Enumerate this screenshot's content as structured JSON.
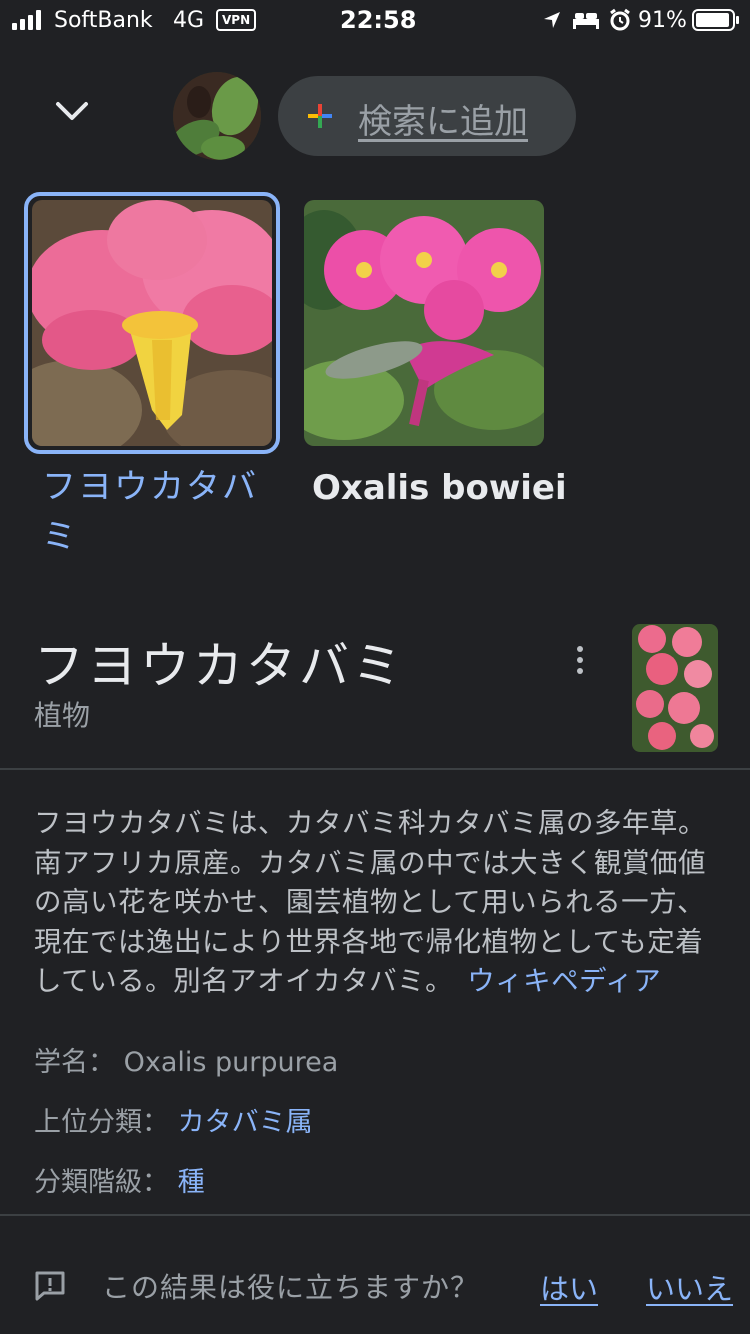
{
  "status_bar": {
    "carrier": "SoftBank",
    "network": "4G",
    "vpn": "VPN",
    "time": "22:58",
    "battery": "91%"
  },
  "header": {
    "add_to_search_label": "検索に追加"
  },
  "suggestions": [
    {
      "label_line1": "フヨウカタバ",
      "label_line2": "ミ",
      "selected": true
    },
    {
      "label": "Oxalis bowiei",
      "selected": false
    }
  ],
  "knowledge_panel": {
    "title": "フヨウカタバミ",
    "subtitle": "植物",
    "description_lines": [
      "フヨウカタバミは、カタバミ科カタバミ属の多年草。",
      "南アフリカ原産。カタバミ属の中では大きく観賞価値",
      "の高い花を咲かせ、園芸植物として用いられる一方、",
      "現在では逸出により世界各地で帰化植物としても定着",
      "している。別名アオイカタバミ。"
    ],
    "source_link": "ウィキペディア",
    "attributes": [
      {
        "key": "学名：",
        "value": "Oxalis purpurea"
      },
      {
        "key": "上位分類：",
        "value": "カタバミ属"
      },
      {
        "key": "分類階級：",
        "value": "種"
      }
    ]
  },
  "feedback": {
    "question": "この結果は役に立ちますか？",
    "yes": "はい",
    "no": "いいえ"
  },
  "colors": {
    "background": "#202124",
    "link": "#8ab4f8",
    "pill": "#3c4043"
  }
}
